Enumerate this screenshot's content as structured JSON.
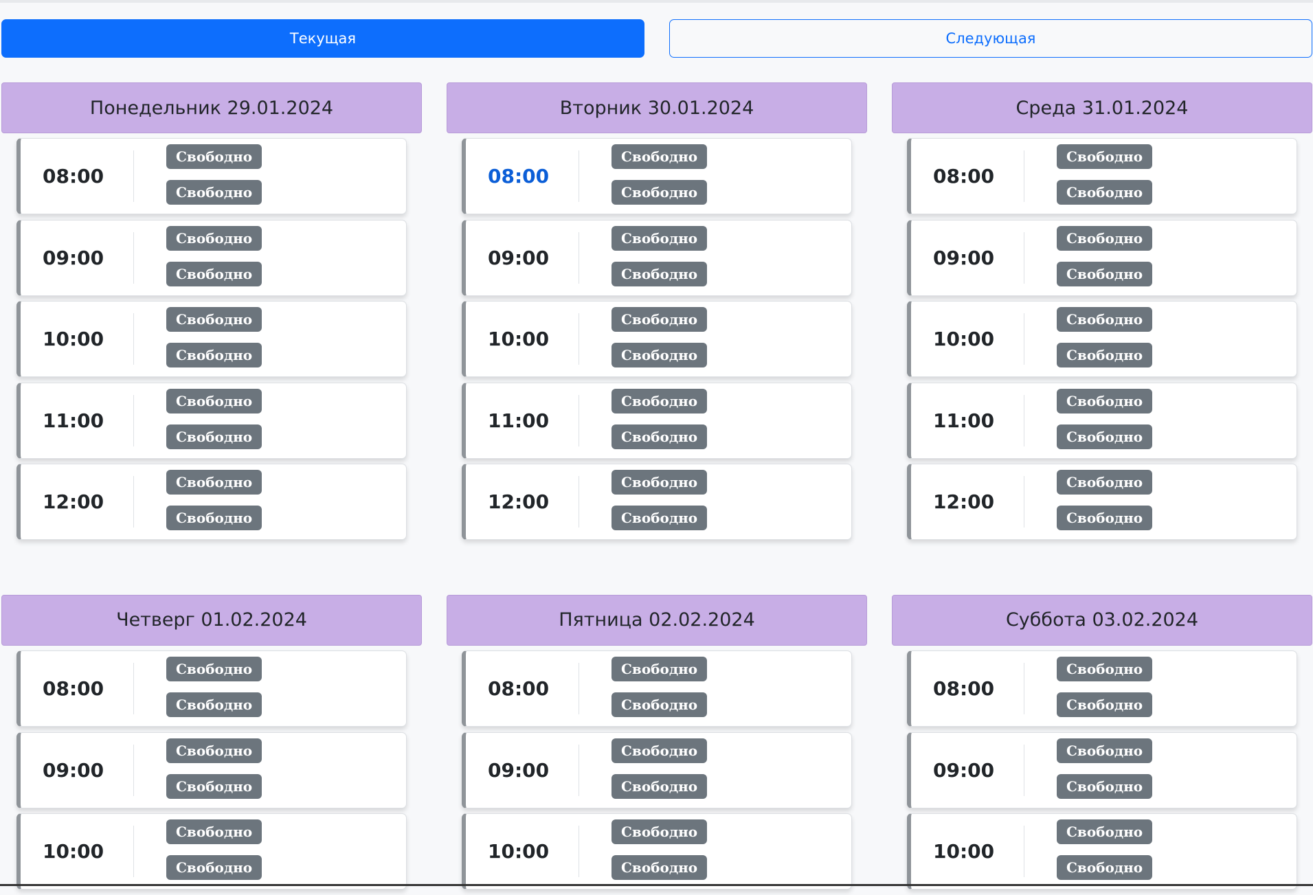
{
  "week_tabs": {
    "current_label": "Текущая",
    "next_label": "Следующая"
  },
  "colors": {
    "primary": "#0d6efd",
    "day_header_bg": "#c8aee6",
    "badge_bg": "#6c757d",
    "active_time": "#0b5ed7"
  },
  "days": [
    {
      "title": "Понедельник 29.01.2024",
      "slots": [
        {
          "time": "08:00",
          "active": false,
          "statuses": [
            "Свободно",
            "Свободно"
          ]
        },
        {
          "time": "09:00",
          "active": false,
          "statuses": [
            "Свободно",
            "Свободно"
          ]
        },
        {
          "time": "10:00",
          "active": false,
          "statuses": [
            "Свободно",
            "Свободно"
          ]
        },
        {
          "time": "11:00",
          "active": false,
          "statuses": [
            "Свободно",
            "Свободно"
          ]
        },
        {
          "time": "12:00",
          "active": false,
          "statuses": [
            "Свободно",
            "Свободно"
          ]
        }
      ]
    },
    {
      "title": "Вторник 30.01.2024",
      "slots": [
        {
          "time": "08:00",
          "active": true,
          "statuses": [
            "Свободно",
            "Свободно"
          ]
        },
        {
          "time": "09:00",
          "active": false,
          "statuses": [
            "Свободно",
            "Свободно"
          ]
        },
        {
          "time": "10:00",
          "active": false,
          "statuses": [
            "Свободно",
            "Свободно"
          ]
        },
        {
          "time": "11:00",
          "active": false,
          "statuses": [
            "Свободно",
            "Свободно"
          ]
        },
        {
          "time": "12:00",
          "active": false,
          "statuses": [
            "Свободно",
            "Свободно"
          ]
        }
      ]
    },
    {
      "title": "Среда 31.01.2024",
      "slots": [
        {
          "time": "08:00",
          "active": false,
          "statuses": [
            "Свободно",
            "Свободно"
          ]
        },
        {
          "time": "09:00",
          "active": false,
          "statuses": [
            "Свободно",
            "Свободно"
          ]
        },
        {
          "time": "10:00",
          "active": false,
          "statuses": [
            "Свободно",
            "Свободно"
          ]
        },
        {
          "time": "11:00",
          "active": false,
          "statuses": [
            "Свободно",
            "Свободно"
          ]
        },
        {
          "time": "12:00",
          "active": false,
          "statuses": [
            "Свободно",
            "Свободно"
          ]
        }
      ]
    },
    {
      "title": "Четверг 01.02.2024",
      "slots": [
        {
          "time": "08:00",
          "active": false,
          "statuses": [
            "Свободно",
            "Свободно"
          ]
        },
        {
          "time": "09:00",
          "active": false,
          "statuses": [
            "Свободно",
            "Свободно"
          ]
        },
        {
          "time": "10:00",
          "active": false,
          "statuses": [
            "Свободно",
            "Свободно"
          ]
        }
      ]
    },
    {
      "title": "Пятница 02.02.2024",
      "slots": [
        {
          "time": "08:00",
          "active": false,
          "statuses": [
            "Свободно",
            "Свободно"
          ]
        },
        {
          "time": "09:00",
          "active": false,
          "statuses": [
            "Свободно",
            "Свободно"
          ]
        },
        {
          "time": "10:00",
          "active": false,
          "statuses": [
            "Свободно",
            "Свободно"
          ]
        }
      ]
    },
    {
      "title": "Суббота 03.02.2024",
      "slots": [
        {
          "time": "08:00",
          "active": false,
          "statuses": [
            "Свободно",
            "Свободно"
          ]
        },
        {
          "time": "09:00",
          "active": false,
          "statuses": [
            "Свободно",
            "Свободно"
          ]
        },
        {
          "time": "10:00",
          "active": false,
          "statuses": [
            "Свободно",
            "Свободно"
          ]
        }
      ]
    }
  ]
}
